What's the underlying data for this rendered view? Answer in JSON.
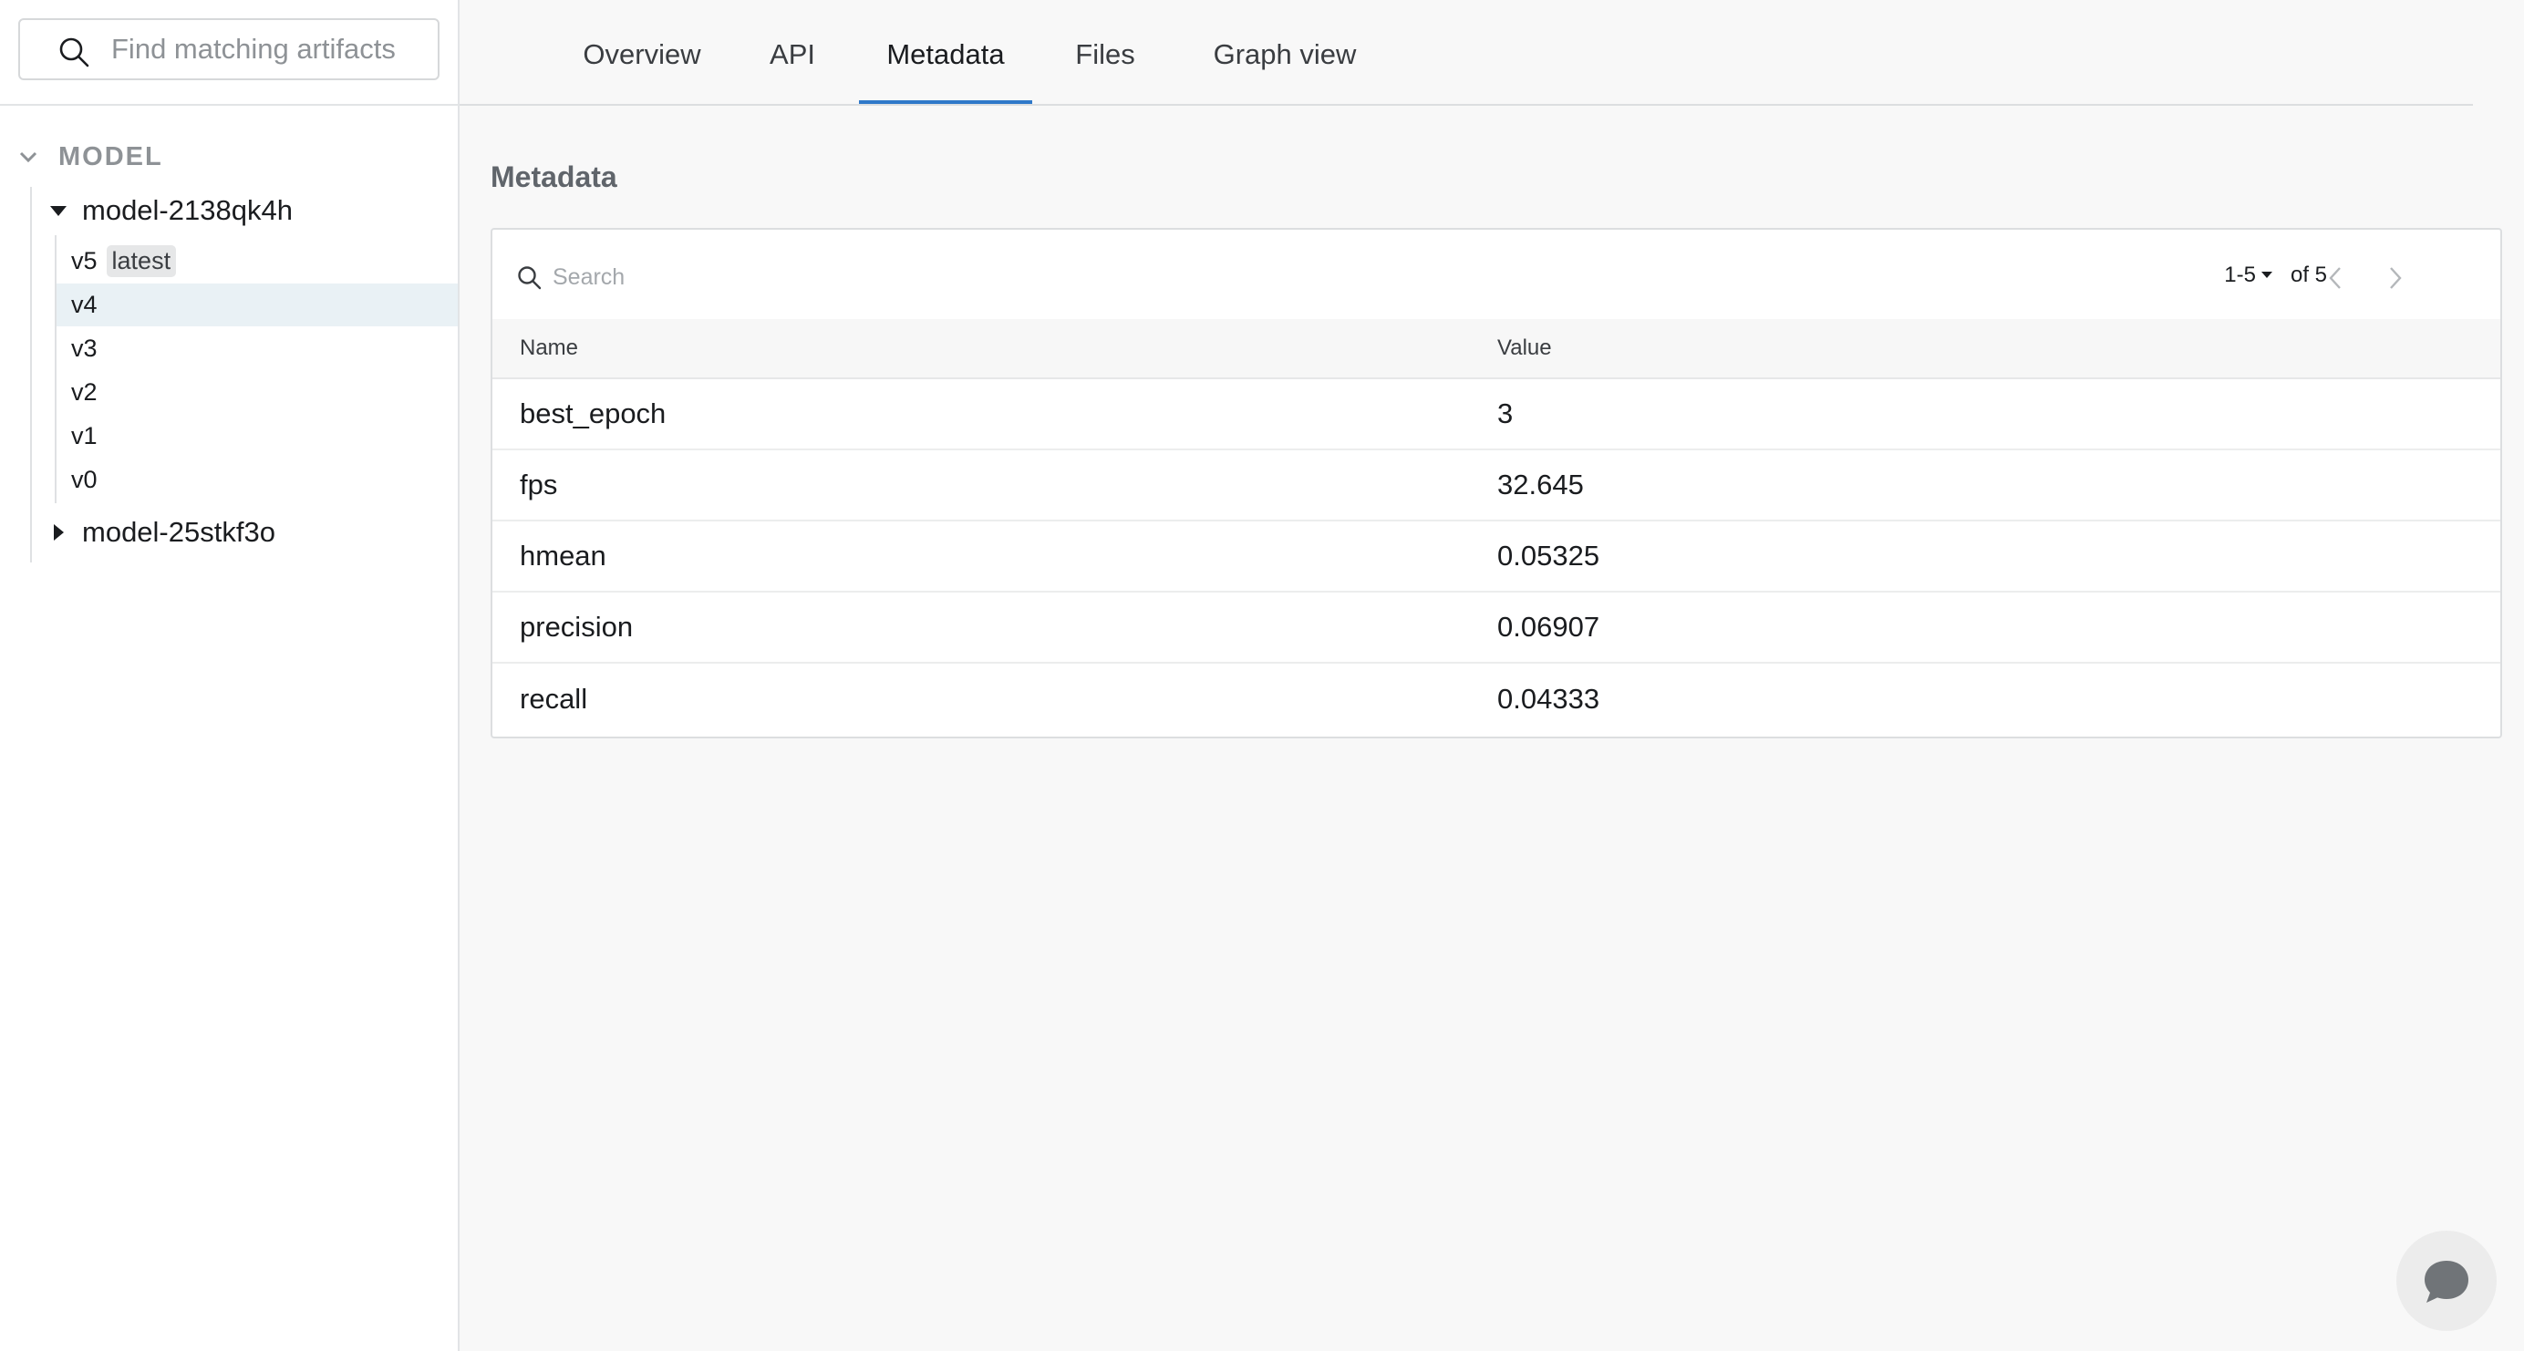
{
  "sidebar": {
    "search_placeholder": "Find matching artifacts",
    "section_label": "MODEL",
    "models": [
      {
        "name": "model-2138qk4h",
        "expanded": true,
        "versions": [
          {
            "label": "v5",
            "alias": "latest",
            "selected": false
          },
          {
            "label": "v4",
            "alias": "",
            "selected": true
          },
          {
            "label": "v3",
            "alias": "",
            "selected": false
          },
          {
            "label": "v2",
            "alias": "",
            "selected": false
          },
          {
            "label": "v1",
            "alias": "",
            "selected": false
          },
          {
            "label": "v0",
            "alias": "",
            "selected": false
          }
        ]
      },
      {
        "name": "model-25stkf3o",
        "expanded": false,
        "versions": []
      }
    ]
  },
  "tabs": [
    {
      "label": "Overview",
      "active": false
    },
    {
      "label": "API",
      "active": false
    },
    {
      "label": "Metadata",
      "active": true
    },
    {
      "label": "Files",
      "active": false
    },
    {
      "label": "Graph view",
      "active": false
    }
  ],
  "metadata": {
    "title": "Metadata",
    "search_placeholder": "Search",
    "pagination": {
      "range": "1-5",
      "of": "of 5"
    },
    "columns": {
      "name": "Name",
      "value": "Value"
    },
    "rows": [
      {
        "name": "best_epoch",
        "value": "3"
      },
      {
        "name": "fps",
        "value": "32.645"
      },
      {
        "name": "hmean",
        "value": "0.05325"
      },
      {
        "name": "precision",
        "value": "0.06907"
      },
      {
        "name": "recall",
        "value": "0.04333"
      }
    ]
  },
  "colors": {
    "accent": "#2f79c9",
    "selected_row": "#e9f1f5"
  },
  "icons": {
    "sidebar_search": "search-icon",
    "section_caret": "chevron-down-icon",
    "tree_expanded": "caret-down-icon",
    "tree_collapsed": "caret-right-icon",
    "pagination_prev": "chevron-left-icon",
    "pagination_next": "chevron-right-icon",
    "chat": "chat-bubble-icon"
  }
}
